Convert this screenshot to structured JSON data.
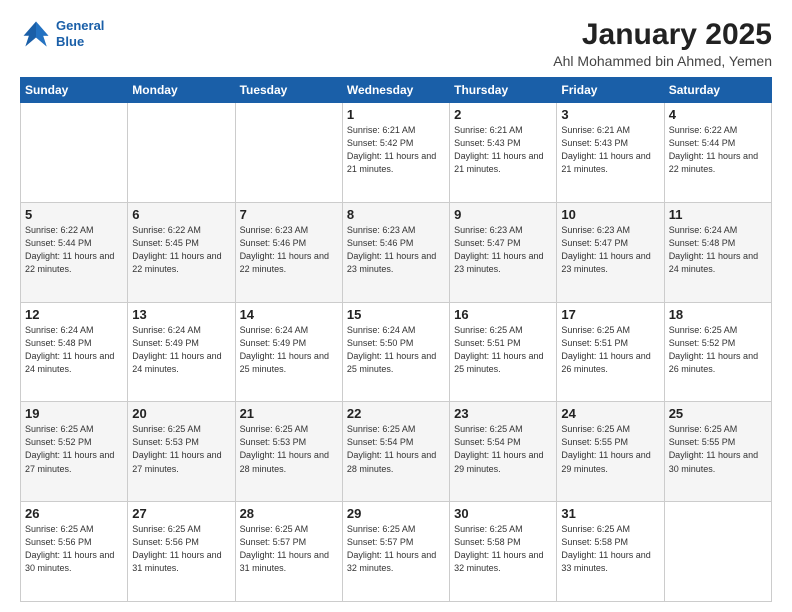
{
  "header": {
    "logo_line1": "General",
    "logo_line2": "Blue",
    "title": "January 2025",
    "subtitle": "Ahl Mohammed bin Ahmed, Yemen"
  },
  "weekdays": [
    "Sunday",
    "Monday",
    "Tuesday",
    "Wednesday",
    "Thursday",
    "Friday",
    "Saturday"
  ],
  "weeks": [
    [
      {
        "day": "",
        "sunrise": "",
        "sunset": "",
        "daylight": ""
      },
      {
        "day": "",
        "sunrise": "",
        "sunset": "",
        "daylight": ""
      },
      {
        "day": "",
        "sunrise": "",
        "sunset": "",
        "daylight": ""
      },
      {
        "day": "1",
        "sunrise": "Sunrise: 6:21 AM",
        "sunset": "Sunset: 5:42 PM",
        "daylight": "Daylight: 11 hours and 21 minutes."
      },
      {
        "day": "2",
        "sunrise": "Sunrise: 6:21 AM",
        "sunset": "Sunset: 5:43 PM",
        "daylight": "Daylight: 11 hours and 21 minutes."
      },
      {
        "day": "3",
        "sunrise": "Sunrise: 6:21 AM",
        "sunset": "Sunset: 5:43 PM",
        "daylight": "Daylight: 11 hours and 21 minutes."
      },
      {
        "day": "4",
        "sunrise": "Sunrise: 6:22 AM",
        "sunset": "Sunset: 5:44 PM",
        "daylight": "Daylight: 11 hours and 22 minutes."
      }
    ],
    [
      {
        "day": "5",
        "sunrise": "Sunrise: 6:22 AM",
        "sunset": "Sunset: 5:44 PM",
        "daylight": "Daylight: 11 hours and 22 minutes."
      },
      {
        "day": "6",
        "sunrise": "Sunrise: 6:22 AM",
        "sunset": "Sunset: 5:45 PM",
        "daylight": "Daylight: 11 hours and 22 minutes."
      },
      {
        "day": "7",
        "sunrise": "Sunrise: 6:23 AM",
        "sunset": "Sunset: 5:46 PM",
        "daylight": "Daylight: 11 hours and 22 minutes."
      },
      {
        "day": "8",
        "sunrise": "Sunrise: 6:23 AM",
        "sunset": "Sunset: 5:46 PM",
        "daylight": "Daylight: 11 hours and 23 minutes."
      },
      {
        "day": "9",
        "sunrise": "Sunrise: 6:23 AM",
        "sunset": "Sunset: 5:47 PM",
        "daylight": "Daylight: 11 hours and 23 minutes."
      },
      {
        "day": "10",
        "sunrise": "Sunrise: 6:23 AM",
        "sunset": "Sunset: 5:47 PM",
        "daylight": "Daylight: 11 hours and 23 minutes."
      },
      {
        "day": "11",
        "sunrise": "Sunrise: 6:24 AM",
        "sunset": "Sunset: 5:48 PM",
        "daylight": "Daylight: 11 hours and 24 minutes."
      }
    ],
    [
      {
        "day": "12",
        "sunrise": "Sunrise: 6:24 AM",
        "sunset": "Sunset: 5:48 PM",
        "daylight": "Daylight: 11 hours and 24 minutes."
      },
      {
        "day": "13",
        "sunrise": "Sunrise: 6:24 AM",
        "sunset": "Sunset: 5:49 PM",
        "daylight": "Daylight: 11 hours and 24 minutes."
      },
      {
        "day": "14",
        "sunrise": "Sunrise: 6:24 AM",
        "sunset": "Sunset: 5:49 PM",
        "daylight": "Daylight: 11 hours and 25 minutes."
      },
      {
        "day": "15",
        "sunrise": "Sunrise: 6:24 AM",
        "sunset": "Sunset: 5:50 PM",
        "daylight": "Daylight: 11 hours and 25 minutes."
      },
      {
        "day": "16",
        "sunrise": "Sunrise: 6:25 AM",
        "sunset": "Sunset: 5:51 PM",
        "daylight": "Daylight: 11 hours and 25 minutes."
      },
      {
        "day": "17",
        "sunrise": "Sunrise: 6:25 AM",
        "sunset": "Sunset: 5:51 PM",
        "daylight": "Daylight: 11 hours and 26 minutes."
      },
      {
        "day": "18",
        "sunrise": "Sunrise: 6:25 AM",
        "sunset": "Sunset: 5:52 PM",
        "daylight": "Daylight: 11 hours and 26 minutes."
      }
    ],
    [
      {
        "day": "19",
        "sunrise": "Sunrise: 6:25 AM",
        "sunset": "Sunset: 5:52 PM",
        "daylight": "Daylight: 11 hours and 27 minutes."
      },
      {
        "day": "20",
        "sunrise": "Sunrise: 6:25 AM",
        "sunset": "Sunset: 5:53 PM",
        "daylight": "Daylight: 11 hours and 27 minutes."
      },
      {
        "day": "21",
        "sunrise": "Sunrise: 6:25 AM",
        "sunset": "Sunset: 5:53 PM",
        "daylight": "Daylight: 11 hours and 28 minutes."
      },
      {
        "day": "22",
        "sunrise": "Sunrise: 6:25 AM",
        "sunset": "Sunset: 5:54 PM",
        "daylight": "Daylight: 11 hours and 28 minutes."
      },
      {
        "day": "23",
        "sunrise": "Sunrise: 6:25 AM",
        "sunset": "Sunset: 5:54 PM",
        "daylight": "Daylight: 11 hours and 29 minutes."
      },
      {
        "day": "24",
        "sunrise": "Sunrise: 6:25 AM",
        "sunset": "Sunset: 5:55 PM",
        "daylight": "Daylight: 11 hours and 29 minutes."
      },
      {
        "day": "25",
        "sunrise": "Sunrise: 6:25 AM",
        "sunset": "Sunset: 5:55 PM",
        "daylight": "Daylight: 11 hours and 30 minutes."
      }
    ],
    [
      {
        "day": "26",
        "sunrise": "Sunrise: 6:25 AM",
        "sunset": "Sunset: 5:56 PM",
        "daylight": "Daylight: 11 hours and 30 minutes."
      },
      {
        "day": "27",
        "sunrise": "Sunrise: 6:25 AM",
        "sunset": "Sunset: 5:56 PM",
        "daylight": "Daylight: 11 hours and 31 minutes."
      },
      {
        "day": "28",
        "sunrise": "Sunrise: 6:25 AM",
        "sunset": "Sunset: 5:57 PM",
        "daylight": "Daylight: 11 hours and 31 minutes."
      },
      {
        "day": "29",
        "sunrise": "Sunrise: 6:25 AM",
        "sunset": "Sunset: 5:57 PM",
        "daylight": "Daylight: 11 hours and 32 minutes."
      },
      {
        "day": "30",
        "sunrise": "Sunrise: 6:25 AM",
        "sunset": "Sunset: 5:58 PM",
        "daylight": "Daylight: 11 hours and 32 minutes."
      },
      {
        "day": "31",
        "sunrise": "Sunrise: 6:25 AM",
        "sunset": "Sunset: 5:58 PM",
        "daylight": "Daylight: 11 hours and 33 minutes."
      },
      {
        "day": "",
        "sunrise": "",
        "sunset": "",
        "daylight": ""
      }
    ]
  ]
}
